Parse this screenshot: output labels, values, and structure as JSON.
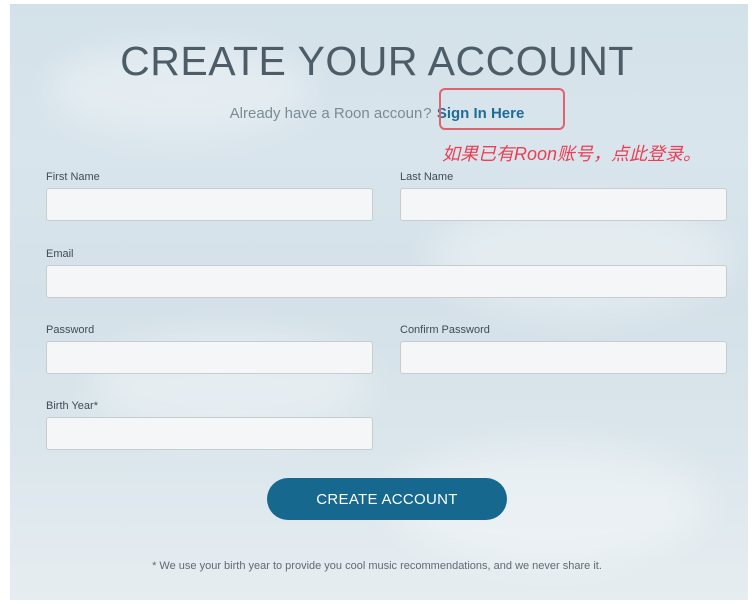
{
  "form": {
    "title": "CREATE YOUR ACCOUNT",
    "signin_prompt": "Already have a Roon accoun",
    "signin_prompt_tail": "?",
    "signin_link": "Sign In Here",
    "fields": {
      "first_name": {
        "label": "First Name",
        "value": ""
      },
      "last_name": {
        "label": "Last Name",
        "value": ""
      },
      "email": {
        "label": "Email",
        "value": ""
      },
      "password": {
        "label": "Password",
        "value": ""
      },
      "confirm_password": {
        "label": "Confirm Password",
        "value": ""
      },
      "birth_year": {
        "label": "Birth Year*",
        "value": ""
      }
    },
    "submit_label": "CREATE ACCOUNT",
    "footnote": "* We use your birth year to provide you cool music recommendations, and we never share it."
  },
  "annotation": {
    "text": "如果已有Roon账号，点此登录。",
    "color": "#ec3e53"
  },
  "colors": {
    "accent": "#17688f",
    "link": "#1f6d97",
    "highlight_border": "#e0616f"
  }
}
